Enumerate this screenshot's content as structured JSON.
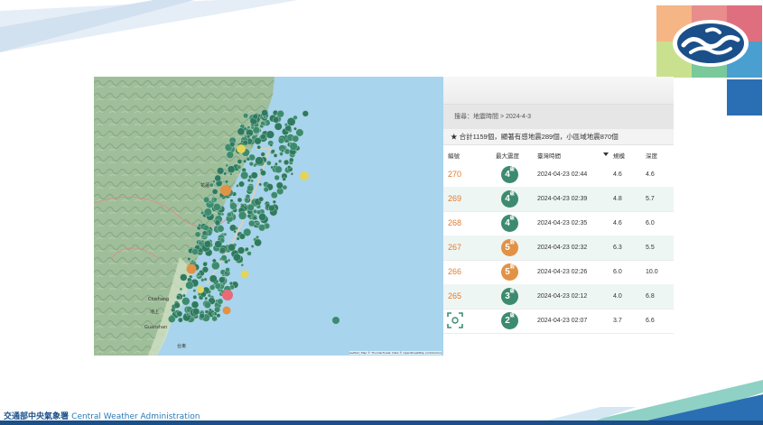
{
  "colors": {
    "accent_blue": "#1b4f8a",
    "row_number": "#e07b2c",
    "intensity_4": "#3d8b6f",
    "intensity_5": "#e29245",
    "intensity_3": "#3d8b6f",
    "intensity_2": "#3d8b6f",
    "map_sea": "#a9d4ee"
  },
  "footer": {
    "org_zh": "交通部中央氣象署",
    "org_en": "Central Weather Administration"
  },
  "map": {
    "place_labels": [
      "花蓮",
      "台東",
      "Chishang",
      "Guanshan",
      "池上",
      "鹿野"
    ],
    "attribution": "Leaflet | Map © Thunderforest, Data © OpenStreetMap contributors"
  },
  "panel": {
    "search_text": "搜尋：地震時間 > 2024-4-3",
    "summary_text": "★ 合計1159個，顯著有感地震289個，小區域地震870個",
    "columns": {
      "no": "編號",
      "intensity": "最大震度",
      "time": "臺灣時間",
      "magnitude": "規模",
      "depth": "深度"
    },
    "sort_icon": "caret-down-icon",
    "rows": [
      {
        "no": "270",
        "intensity": "4",
        "level": "級",
        "time": "2024-04-23 02:44",
        "magnitude": "4.6",
        "depth": "4.6"
      },
      {
        "no": "269",
        "intensity": "4",
        "level": "級",
        "time": "2024-04-23 02:39",
        "magnitude": "4.8",
        "depth": "5.7"
      },
      {
        "no": "268",
        "intensity": "4",
        "level": "級",
        "time": "2024-04-23 02:35",
        "magnitude": "4.6",
        "depth": "6.0"
      },
      {
        "no": "267",
        "intensity": "5",
        "level": "弱",
        "time": "2024-04-23 02:32",
        "magnitude": "6.3",
        "depth": "5.5"
      },
      {
        "no": "266",
        "intensity": "5",
        "level": "弱",
        "time": "2024-04-23 02:26",
        "magnitude": "6.0",
        "depth": "10.0"
      },
      {
        "no": "265",
        "intensity": "3",
        "level": "級",
        "time": "2024-04-23 02:12",
        "magnitude": "4.0",
        "depth": "6.8"
      },
      {
        "no": "",
        "intensity": "2",
        "level": "級",
        "time": "2024-04-23 02:07",
        "magnitude": "3.7",
        "depth": "6.6"
      }
    ]
  }
}
